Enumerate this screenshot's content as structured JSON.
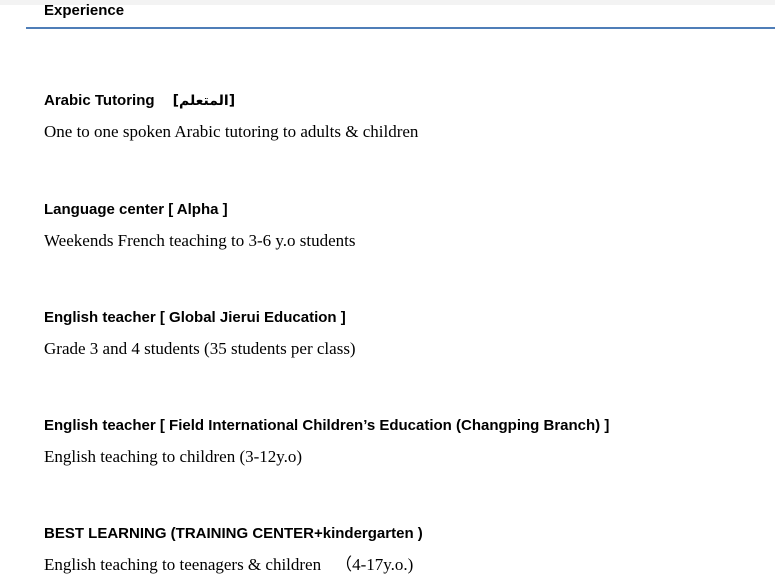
{
  "section": {
    "title": "Experience"
  },
  "entries": [
    {
      "title": "Arabic Tutoring",
      "tag": "[المتعلم]",
      "description": "One to one spoken Arabic tutoring to adults & children"
    },
    {
      "title": "Language center [ Alpha ]",
      "description": "Weekends French teaching to 3-6 y.o students"
    },
    {
      "title": "English teacher [ Global Jierui Education ]",
      "description": "Grade 3 and 4 students (35 students per class)"
    },
    {
      "title": "English teacher [ Field International Children’s Education (Changping Branch) ]",
      "description": "English teaching to children (3-12y.o)"
    },
    {
      "title": "BEST LEARNING (TRAINING CENTER+kindergarten )",
      "description": "English teaching to teenagers & children",
      "age_note": "（4-17y.o.)"
    }
  ],
  "colors": {
    "rule": "#4f7eb8"
  }
}
